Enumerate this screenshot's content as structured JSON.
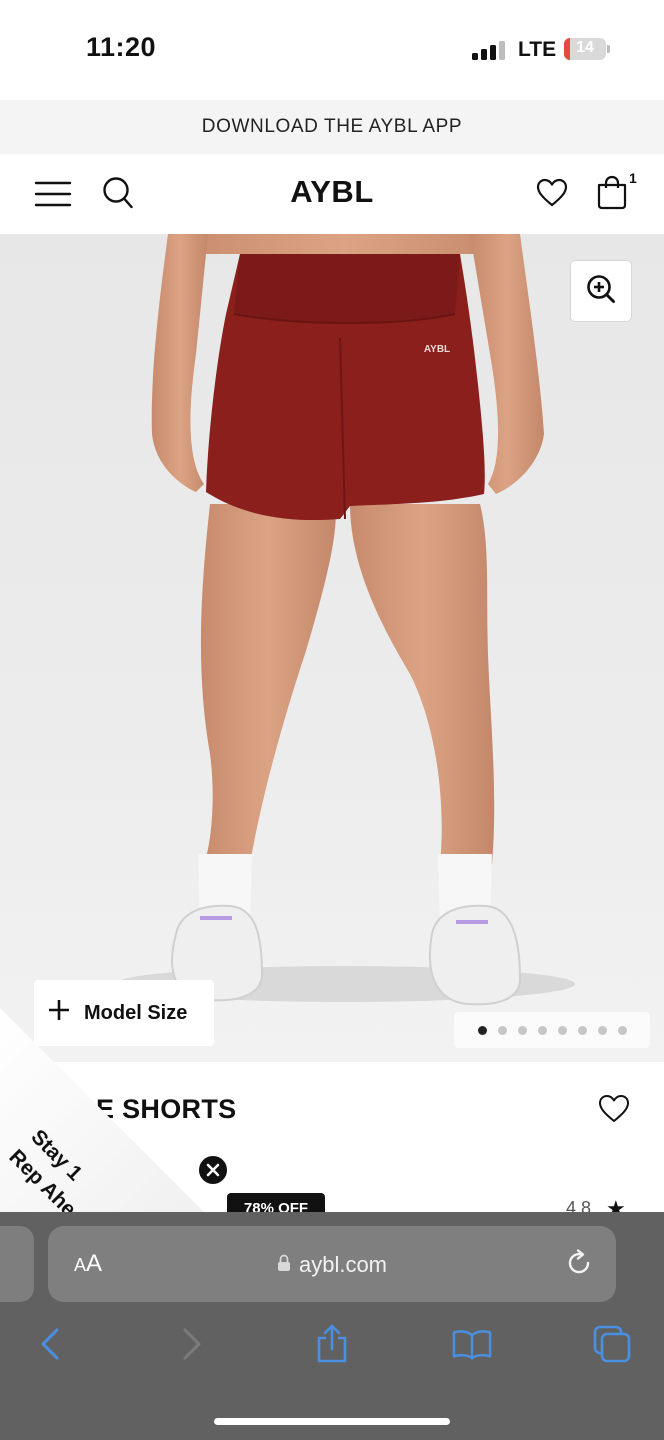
{
  "status_bar": {
    "time": "11:20",
    "network": "LTE",
    "battery": "14",
    "battery_level_percent": 14,
    "signal_bars_active": 3,
    "signal_bars_total": 4
  },
  "promo_banner": {
    "text": "DOWNLOAD THE AYBL APP"
  },
  "header": {
    "logo": "AYBL",
    "cart_count": "1",
    "icons": [
      "menu-icon",
      "search-icon",
      "heart-icon",
      "bag-icon"
    ]
  },
  "hero": {
    "model_size_label": "Model Size",
    "gallery_total": 8,
    "gallery_active_index": 0,
    "shorts_color": "#8a1f1c",
    "waistband_logo": "AYBL"
  },
  "product": {
    "title_partial": "E SHORTS",
    "discount_badge": "78% OFF",
    "rating": "4.8"
  },
  "sticker": {
    "line1": "Stay 1",
    "line2": "Rep Ahead"
  },
  "browser": {
    "text_size_label": "AA",
    "domain": "aybl.com",
    "accent_color": "#4a90e2"
  }
}
